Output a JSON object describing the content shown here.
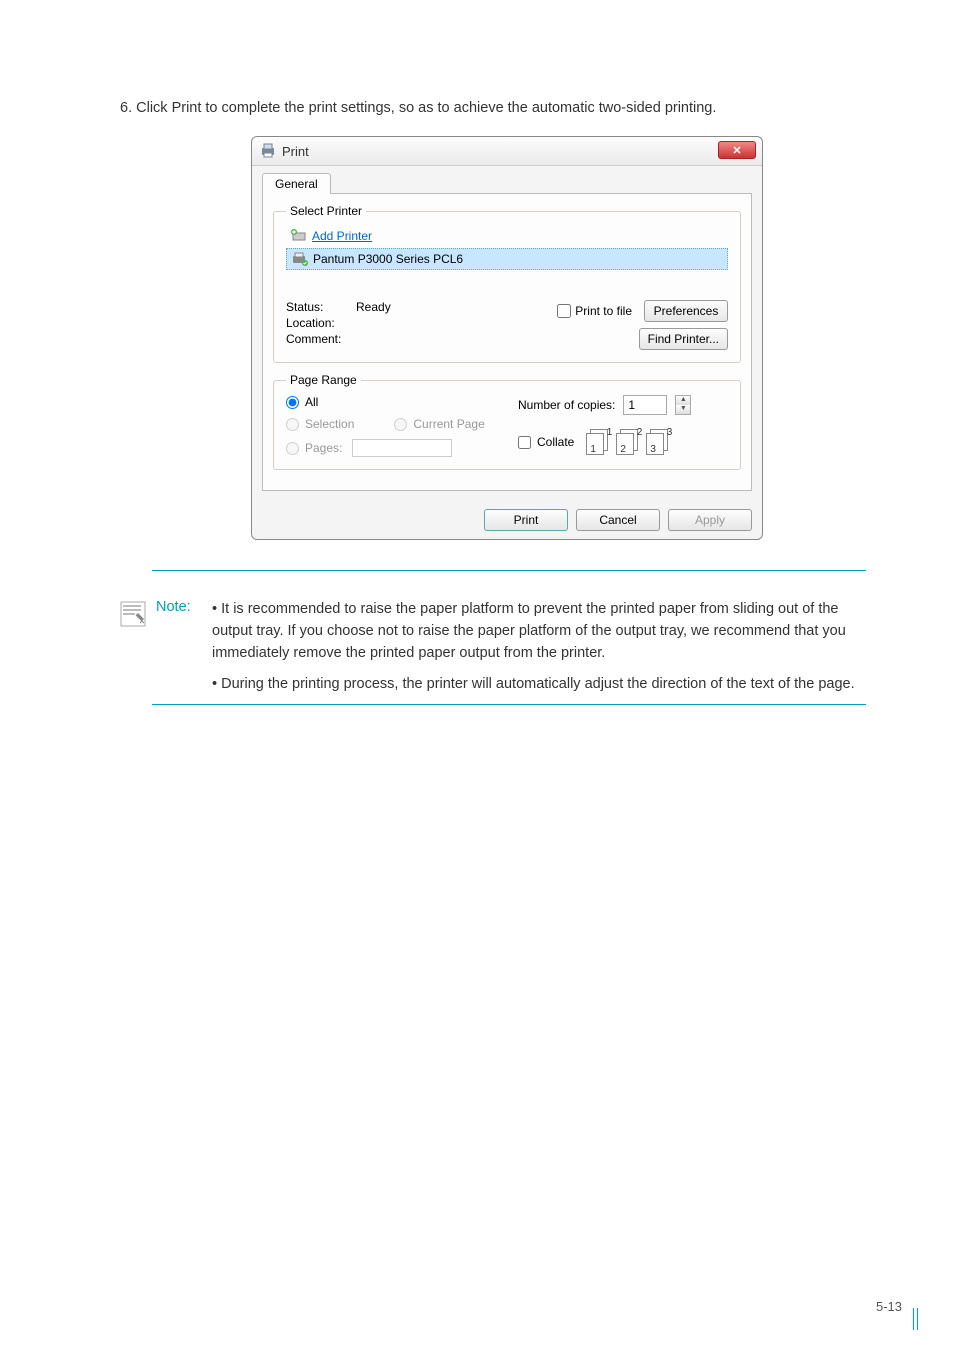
{
  "instruction": "6. Click Print to complete the print settings, so as to achieve the automatic two-sided printing.",
  "dialog": {
    "title": "Print",
    "tab_general": "General",
    "select_printer_legend": "Select Printer",
    "printers": {
      "add": "Add Printer",
      "selected": "Pantum P3000 Series PCL6"
    },
    "status_label": "Status:",
    "status_value": "Ready",
    "location_label": "Location:",
    "comment_label": "Comment:",
    "print_to_file": "Print to file",
    "preferences_btn": "Preferences",
    "find_printer_btn": "Find Printer...",
    "page_range_legend": "Page Range",
    "all_label": "All",
    "selection_label": "Selection",
    "current_page_label": "Current Page",
    "pages_label": "Pages:",
    "num_copies_label": "Number of copies:",
    "num_copies_value": "1",
    "collate_label": "Collate",
    "collate_nums": [
      "1",
      "1",
      "2",
      "2",
      "3",
      "3"
    ],
    "print_btn": "Print",
    "cancel_btn": "Cancel",
    "apply_btn": "Apply"
  },
  "note": {
    "label": "Note:",
    "p1": "• It is recommended to raise the paper platform to prevent the printed paper from sliding out of the output tray. If you choose not to raise the paper platform of the output tray, we recommend that you immediately remove the printed paper output from the printer.",
    "p2": "• During the printing process, the printer will automatically adjust the direction of the text of the page."
  },
  "page_number": "5-13"
}
